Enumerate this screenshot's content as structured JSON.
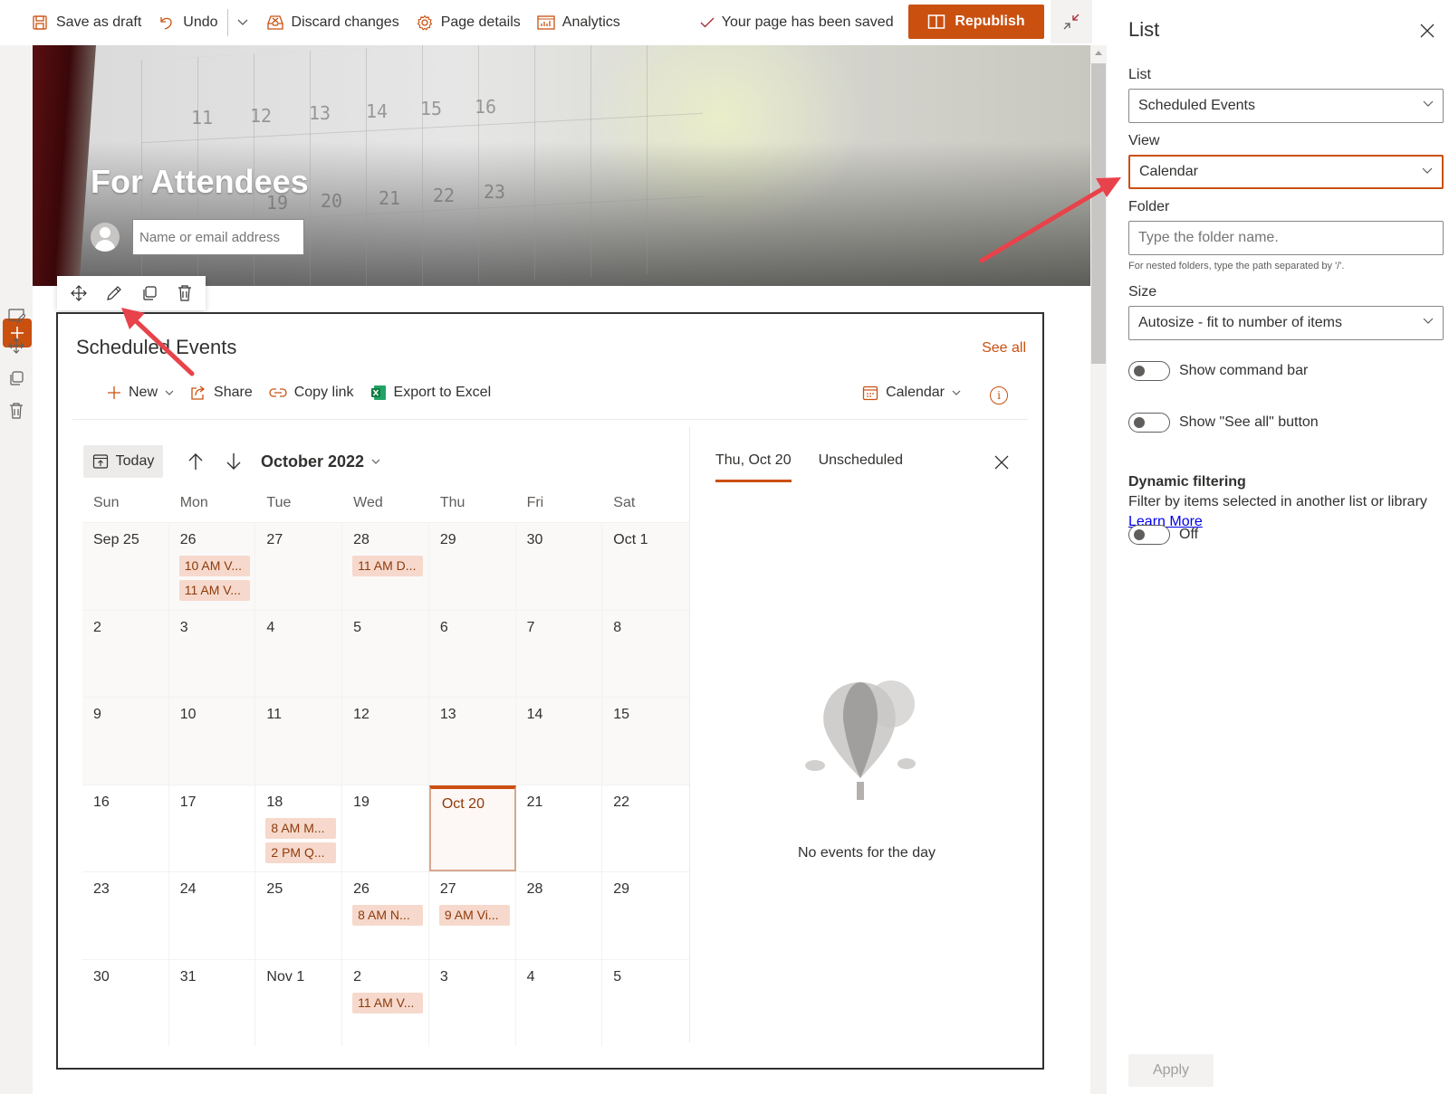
{
  "toolbar": {
    "save_draft": "Save as draft",
    "undo": "Undo",
    "discard": "Discard changes",
    "page_details": "Page details",
    "analytics": "Analytics",
    "saved_status": "Your page has been saved",
    "republish": "Republish",
    "accent": "#ca5010"
  },
  "hero": {
    "title": "For Attendees",
    "author_placeholder": "Name or email address",
    "background_numbers": [
      "11",
      "12",
      "13",
      "14",
      "15",
      "16",
      "19",
      "20",
      "21",
      "22",
      "23"
    ]
  },
  "webpart": {
    "title": "Scheduled Events",
    "see_all": "See all",
    "commands": {
      "new": "New",
      "share": "Share",
      "copy_link": "Copy link",
      "export": "Export to Excel"
    },
    "view_selector": "Calendar",
    "info_glyph": "i"
  },
  "calendar": {
    "today_label": "Today",
    "month_label": "October 2022",
    "weekdays": [
      "Sun",
      "Mon",
      "Tue",
      "Wed",
      "Thu",
      "Fri",
      "Sat"
    ],
    "weeks": [
      [
        {
          "date": "Sep 25",
          "events": []
        },
        {
          "date": "26",
          "events": [
            "10 AM V...",
            "11 AM V..."
          ]
        },
        {
          "date": "27",
          "events": []
        },
        {
          "date": "28",
          "events": [
            "11 AM D..."
          ]
        },
        {
          "date": "29",
          "events": []
        },
        {
          "date": "30",
          "events": []
        },
        {
          "date": "Oct 1",
          "events": []
        }
      ],
      [
        {
          "date": "2",
          "events": []
        },
        {
          "date": "3",
          "events": []
        },
        {
          "date": "4",
          "events": []
        },
        {
          "date": "5",
          "events": []
        },
        {
          "date": "6",
          "events": []
        },
        {
          "date": "7",
          "events": []
        },
        {
          "date": "8",
          "events": []
        }
      ],
      [
        {
          "date": "9",
          "events": []
        },
        {
          "date": "10",
          "events": []
        },
        {
          "date": "11",
          "events": []
        },
        {
          "date": "12",
          "events": []
        },
        {
          "date": "13",
          "events": []
        },
        {
          "date": "14",
          "events": []
        },
        {
          "date": "15",
          "events": []
        }
      ],
      [
        {
          "date": "16",
          "events": []
        },
        {
          "date": "17",
          "events": []
        },
        {
          "date": "18",
          "events": [
            "8 AM M...",
            "2 PM Q..."
          ]
        },
        {
          "date": "19",
          "events": []
        },
        {
          "date": "Oct 20",
          "events": [],
          "today": true
        },
        {
          "date": "21",
          "events": []
        },
        {
          "date": "22",
          "events": []
        }
      ],
      [
        {
          "date": "23",
          "events": []
        },
        {
          "date": "24",
          "events": []
        },
        {
          "date": "25",
          "events": []
        },
        {
          "date": "26",
          "events": [
            "8 AM N..."
          ]
        },
        {
          "date": "27",
          "events": [
            "9 AM Vi..."
          ]
        },
        {
          "date": "28",
          "events": []
        },
        {
          "date": "29",
          "events": []
        }
      ],
      [
        {
          "date": "30",
          "events": []
        },
        {
          "date": "31",
          "events": []
        },
        {
          "date": "Nov 1",
          "events": []
        },
        {
          "date": "2",
          "events": [
            "11 AM V..."
          ]
        },
        {
          "date": "3",
          "events": []
        },
        {
          "date": "4",
          "events": []
        },
        {
          "date": "5",
          "events": []
        }
      ]
    ],
    "day_panel": {
      "tabs": [
        "Thu, Oct 20",
        "Unscheduled"
      ],
      "active_tab": 0,
      "empty_message": "No events for the day"
    }
  },
  "property_pane": {
    "title": "List",
    "list_label": "List",
    "list_value": "Scheduled Events",
    "view_label": "View",
    "view_value": "Calendar",
    "folder_label": "Folder",
    "folder_placeholder": "Type the folder name.",
    "folder_hint": "For nested folders, type the path separated by '/'.",
    "size_label": "Size",
    "size_value": "Autosize - fit to number of items",
    "toggles": {
      "command_bar": {
        "label": "Show command bar",
        "on": false
      },
      "see_all": {
        "label": "Show \"See all\" button",
        "on": false
      }
    },
    "dynamic_filtering": {
      "label": "Dynamic filtering",
      "description": "Filter by items selected in another list or library",
      "learn_more": "Learn More",
      "toggle_label": "Off",
      "on": false
    },
    "apply": "Apply"
  }
}
